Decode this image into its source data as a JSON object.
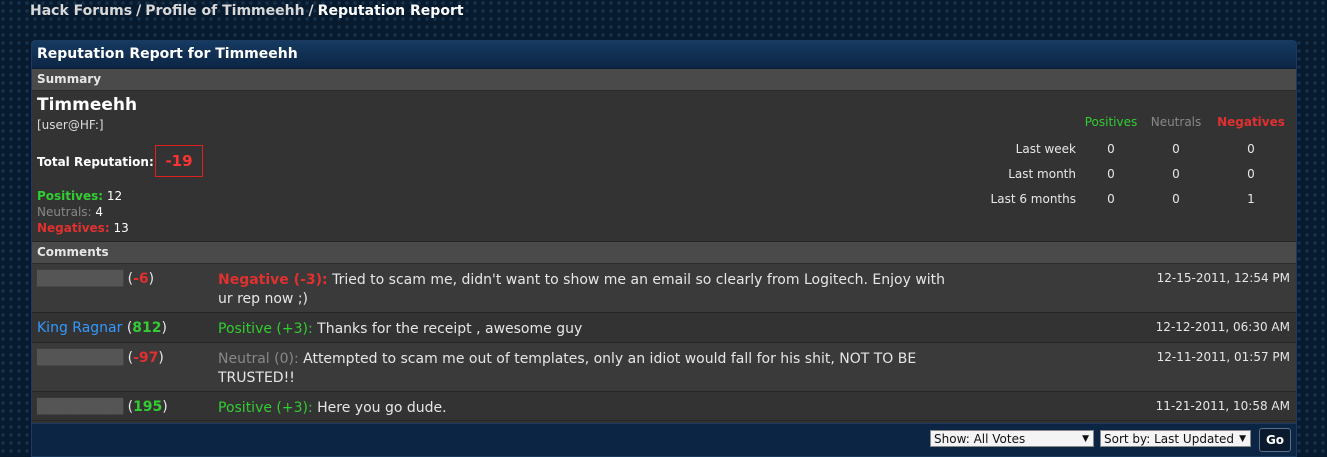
{
  "breadcrumb": {
    "items": [
      "Hack Forums",
      "Profile of Timmeehh"
    ],
    "separator": "/",
    "current": "Reputation Report"
  },
  "panel": {
    "title": "Reputation Report for Timmeehh"
  },
  "summary": {
    "section_label": "Summary",
    "username": "Timmeehh",
    "user_title": "[user@HF:]",
    "total_label": "Total Reputation:",
    "total_value": "-19",
    "positives_label": "Positives:",
    "positives_value": "12",
    "neutrals_label": "Neutrals:",
    "neutrals_value": "4",
    "negatives_label": "Negatives:",
    "negatives_value": "13",
    "stats": {
      "headers": [
        "Positives",
        "Neutrals",
        "Negatives"
      ],
      "rows": [
        {
          "label": "Last week",
          "values": [
            "0",
            "0",
            "0"
          ]
        },
        {
          "label": "Last month",
          "values": [
            "0",
            "0",
            "0"
          ]
        },
        {
          "label": "Last 6 months",
          "values": [
            "0",
            "0",
            "1"
          ]
        }
      ]
    }
  },
  "comments": {
    "section_label": "Comments",
    "items": [
      {
        "user": "████████",
        "user_rep": "-6",
        "vote_label": "Negative (-3):",
        "text": "Tried to scam me, didn't want to show me an email so clearly from Logitech. Enjoy with ur rep now ;)",
        "date": "12-15-2011, 12:54 PM"
      },
      {
        "user": "King Ragnar",
        "user_rep": "812",
        "vote_label": "Positive (+3):",
        "text": "Thanks for the receipt , awesome guy",
        "date": "12-12-2011, 06:30 AM"
      },
      {
        "user": "████████",
        "user_rep": "-97",
        "vote_label": "Neutral (0):",
        "text": "Attempted to scam me out of templates, only an idiot would fall for his shit, NOT TO BE TRUSTED!!",
        "date": "12-11-2011, 01:57 PM"
      },
      {
        "user": "████████",
        "user_rep": "195",
        "vote_label": "Positive (+3):",
        "text": "Here you go dude.",
        "date": "11-21-2011, 10:58 AM"
      }
    ]
  },
  "footer": {
    "show_select": "Show: All Votes",
    "sort_select": "Sort by: Last Updated",
    "go_label": "Go"
  }
}
